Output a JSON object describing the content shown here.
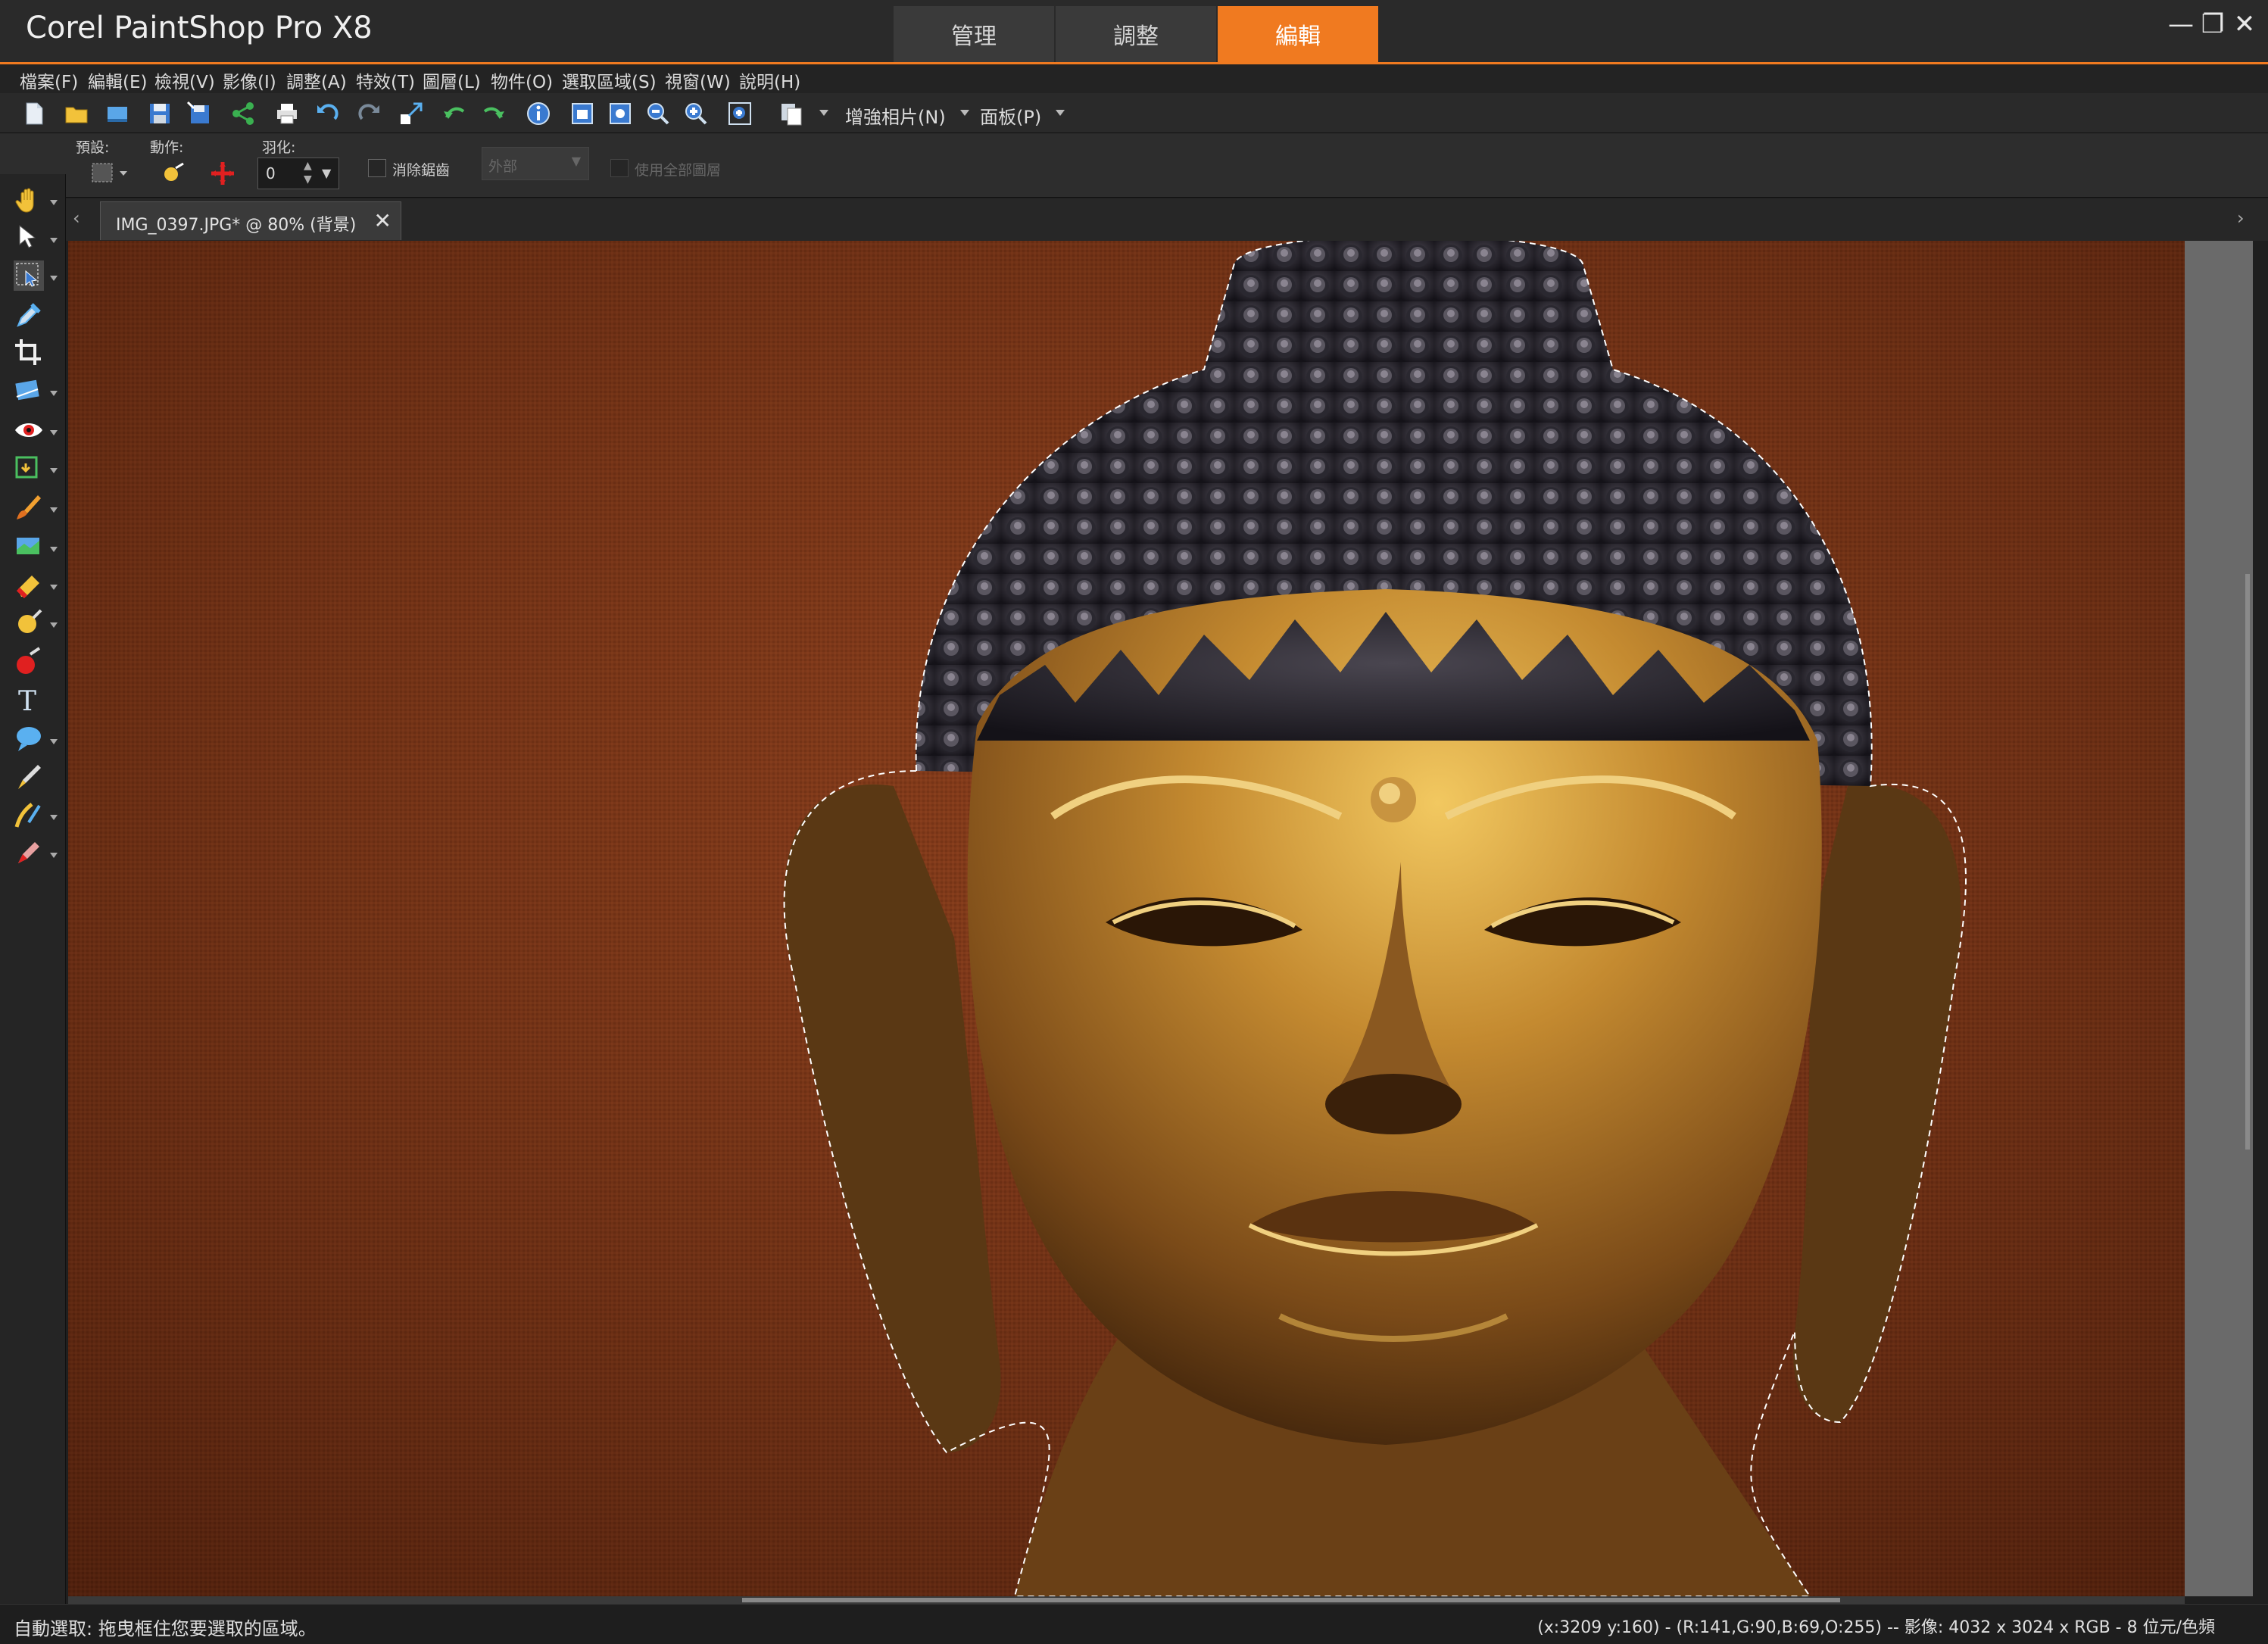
{
  "app": {
    "title": "Corel PaintShop Pro X8"
  },
  "workspace_tabs": [
    {
      "label": "管理",
      "active": false
    },
    {
      "label": "調整",
      "active": false
    },
    {
      "label": "編輯",
      "active": true
    }
  ],
  "window_controls": {
    "minimize": "—",
    "maximize": "❐",
    "close": "✕"
  },
  "menu": [
    "檔案(F)",
    "編輯(E)",
    "檢視(V)",
    "影像(I)",
    "調整(A)",
    "特效(T)",
    "圖層(L)",
    "物件(O)",
    "選取區域(S)",
    "視窗(W)",
    "說明(H)"
  ],
  "toolbar": {
    "enhance_photo_label": "增強相片(N)",
    "panels_label": "面板(P)",
    "icons": [
      "new-icon",
      "open-icon",
      "scan-icon",
      "save-icon",
      "save-as-icon",
      "share-icon",
      "print-icon",
      "undo-icon",
      "redo-icon",
      "resize-icon",
      "rotate-left-icon",
      "rotate-right-icon",
      "info-icon",
      "fit-icon",
      "actual-size-icon",
      "zoom-out-icon",
      "zoom-in-icon",
      "zoom-window-icon",
      "copy-merged-icon"
    ]
  },
  "tool_options": {
    "preset_label": "預設:",
    "action_label": "動作:",
    "feather_label": "羽化:",
    "feather_value": "0",
    "antialias_label": "消除鋸齒",
    "style_value": "外部",
    "use_all_layers_label": "使用全部圖層"
  },
  "document_tab": {
    "label": "IMG_0397.JPG* @  80% (背景)",
    "close": "✕"
  },
  "tabstrip": {
    "scroll_left": "‹",
    "scroll_right": "›"
  },
  "tools": [
    "pan-tool-icon",
    "pick-tool-icon",
    "auto-selection-tool-icon",
    "dropper-tool-icon",
    "crop-tool-icon",
    "straighten-tool-icon",
    "red-eye-tool-icon",
    "object-remover-tool-icon",
    "paint-brush-tool-icon",
    "clone-brush-tool-icon",
    "eraser-tool-icon",
    "dodge-tool-icon",
    "flood-fill-tool-icon",
    "text-tool-icon",
    "preset-shape-tool-icon",
    "pen-tool-icon",
    "art-media-tool-icon",
    "color-replacer-tool-icon"
  ],
  "status": {
    "left": "自動選取: 拖曳框住您要選取的區域。",
    "right": "(x:3209 y:160) - (R:141,G:90,B:69,O:255) -- 影像: 4032 x 3024 x RGB - 8 位元/色頻"
  },
  "colors": {
    "accent": "#f07a20",
    "canvas_bg": "#7a3518",
    "statue_gold": "#b07a28"
  }
}
